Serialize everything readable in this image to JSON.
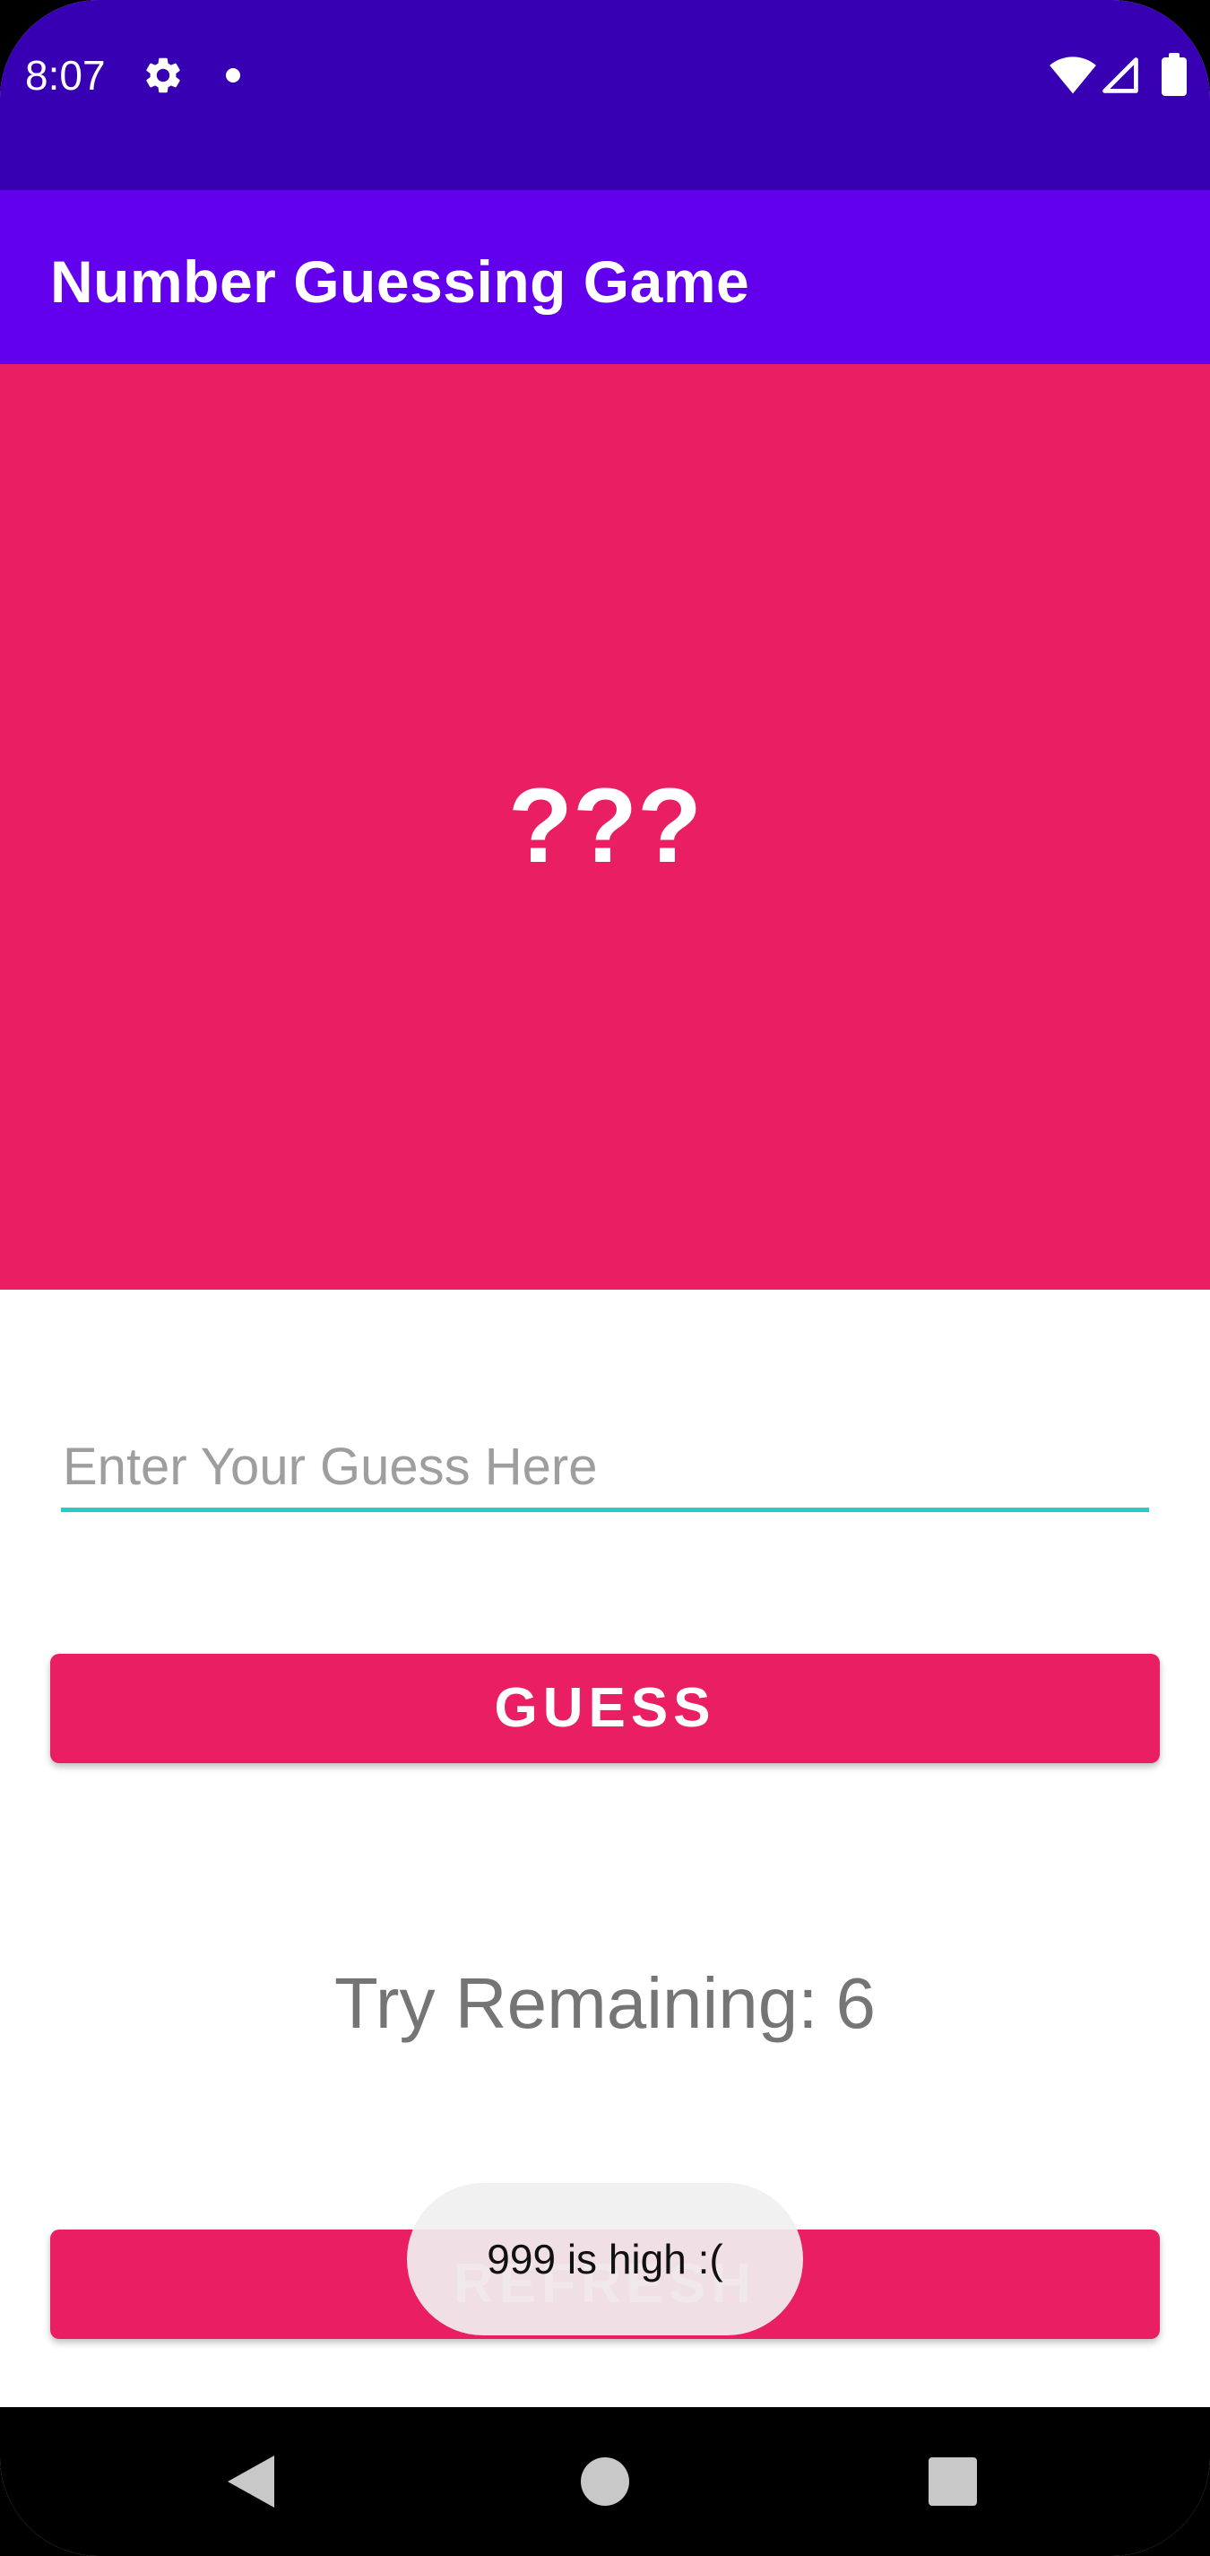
{
  "status_bar": {
    "time": "8:07",
    "icons": [
      "gear-icon",
      "dot-icon",
      "wifi-icon",
      "signal-icon",
      "battery-icon"
    ]
  },
  "app_bar": {
    "title": "Number Guessing Game"
  },
  "secret": {
    "text": "???"
  },
  "guess_input": {
    "value": "",
    "placeholder": "Enter Your Guess Here"
  },
  "buttons": {
    "guess_label": "GUESS",
    "refresh_label": "REFRESH"
  },
  "tries": {
    "label": "Try Remaining:",
    "count": "6"
  },
  "toast": {
    "message": "999 is high :("
  },
  "nav_bar": {
    "icons": [
      "back-icon",
      "home-icon",
      "recents-icon"
    ]
  },
  "colors": {
    "status_bar": "#3700B3",
    "app_bar": "#6200EE",
    "accent_pink": "#E91E63",
    "input_underline": "#24CEC0",
    "muted_text": "#757575"
  }
}
